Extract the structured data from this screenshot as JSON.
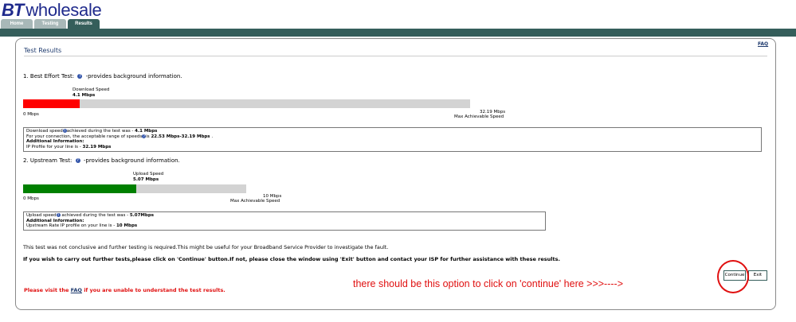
{
  "header": {
    "logo_bt": "BT",
    "logo_text": "wholesale",
    "tabs": [
      {
        "label": "Home"
      },
      {
        "label": "Testing"
      },
      {
        "label": "Results"
      }
    ]
  },
  "page": {
    "faq_link": "FAQ",
    "title": "Test Results"
  },
  "best_effort": {
    "heading": "1. Best Effort Test:",
    "heading_suffix": "-provides background information.",
    "speed_label": "Download Speed",
    "speed_value": "4.1 Mbps",
    "min_label": "0 Mbps",
    "max_value": "32.19 Mbps",
    "max_label": "Max Achievable Speed",
    "progress_fraction": 0.1274,
    "bar_color": "#ff0000",
    "info": {
      "line1_prefix": "Download speed",
      "line1_mid": "achieved during the test was - ",
      "line1_value": "4.1 Mbps",
      "line2_prefix": "For your connection, the acceptable range of speeds",
      "line2_mid": "is ",
      "line2_value": "22.53 Mbps-32.19 Mbps",
      "line2_suffix": " .",
      "additional_heading": "Additional Information:",
      "line3_prefix": "IP Profile for your line is - ",
      "line3_value": "32.19 Mbps"
    }
  },
  "upstream": {
    "heading": "2. Upstream Test:",
    "heading_suffix": "-provides background information.",
    "speed_label": "Upload Speed",
    "speed_value": "5.07 Mbps",
    "min_label": "0 Mbps",
    "max_value": "10 Mbps",
    "max_label": "Max Achievable Speed",
    "progress_fraction": 0.507,
    "bar_color": "#008000",
    "info": {
      "line1_prefix": "Upload speed",
      "line1_mid": " achieved during the test was - ",
      "line1_value": "5.07Mbps",
      "additional_heading": "Additional Information:",
      "line3_prefix": "Upstream Rate IP profile on your line is - ",
      "line3_value": "10 Mbps"
    }
  },
  "messages": {
    "inconclusive": "This test was not conclusive and further testing is required.This might be useful for your Broadband Service Provider to investigate the fault.",
    "instruction": "If you wish to carry out further tests,please click on 'Continue' button.If not, please close the window using 'Exit' button and contact your ISP for further assistance with these results.",
    "visit_prefix": "Please visit the ",
    "visit_link": "FAQ",
    "visit_suffix": " if you are unable to understand the test results."
  },
  "buttons": {
    "continue_label": "Continue",
    "exit_label": "Exit"
  },
  "annotation": {
    "text": "there should be this option to click on 'continue' here >>>---->"
  },
  "colors": {
    "brand_dark_teal": "#355e5b",
    "logo_blue": "#1f2a8c",
    "annotation_red": "#e01010"
  },
  "icons": {
    "help": "question-circle-icon"
  }
}
